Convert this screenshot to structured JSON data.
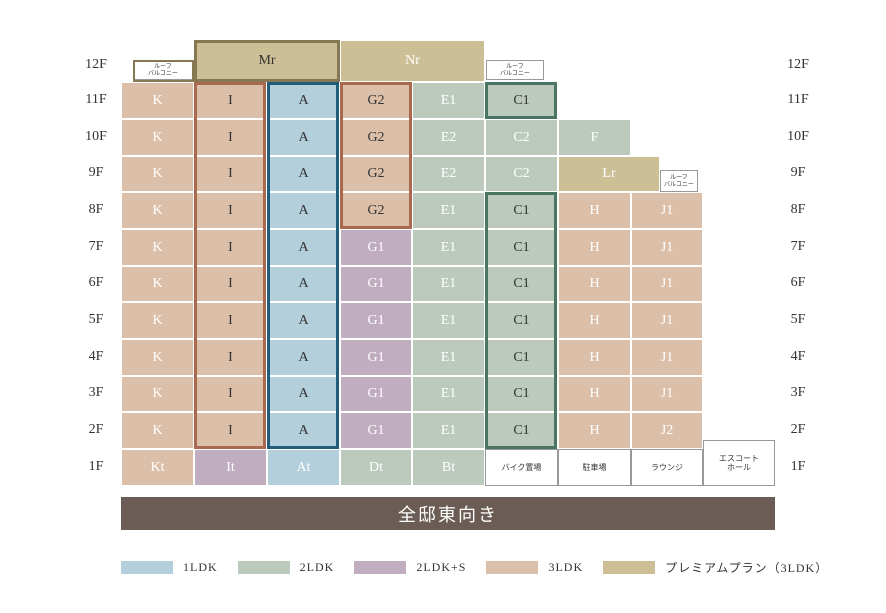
{
  "floors": [
    "12F",
    "11F",
    "10F",
    "9F",
    "8F",
    "7F",
    "6F",
    "5F",
    "4F",
    "3F",
    "2F",
    "1F"
  ],
  "banner": "全邸東向き",
  "colors": {
    "1ldk": "#b3cfdb",
    "2ldk": "#bccabd",
    "2ldk_s": "#c0adc0",
    "3ldk": "#dcbfa9",
    "premium": "#ccbf96",
    "hl_3ldk": "#a9694f",
    "hl_1ldk": "#215d78",
    "hl_2ldk": "#4a7563",
    "hl_premium": "#857853",
    "banner": "#6b5d55"
  },
  "legend": [
    {
      "label": "1LDK",
      "color_key": "1ldk"
    },
    {
      "label": "2LDK",
      "color_key": "2ldk"
    },
    {
      "label": "2LDK+S",
      "color_key": "2ldk_s"
    },
    {
      "label": "3LDK",
      "color_key": "3ldk"
    },
    {
      "label": "プレミアムプラン（3LDK）",
      "color_key": "premium"
    }
  ],
  "labels": {
    "roof_balcony": "ルーフ\nバルコニー",
    "bike": "バイク置場",
    "parking": "駐車場",
    "lounge": "ラウンジ",
    "escort_hall": "エスコート\nホール"
  },
  "units": {
    "mr": "Mr",
    "nr": "Nr",
    "lr": "Lr",
    "K": "K",
    "I": "I",
    "A": "A",
    "G1": "G1",
    "G2": "G2",
    "E1": "E1",
    "E2": "E2",
    "C1": "C1",
    "C2": "C2",
    "F": "F",
    "H": "H",
    "J1": "J1",
    "J2": "J2",
    "Kt": "Kt",
    "It": "It",
    "At": "At",
    "Dt": "Dt",
    "Bt": "Bt"
  }
}
